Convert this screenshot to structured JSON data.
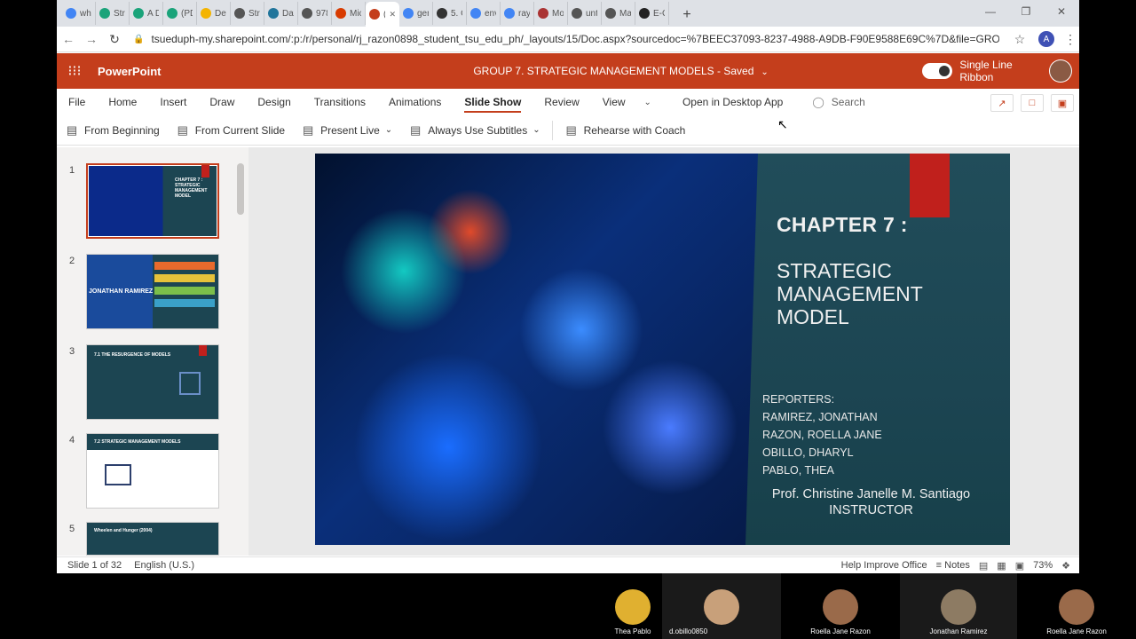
{
  "browser": {
    "tabs": [
      {
        "title": "wh",
        "icon": "google-icon",
        "color": "#4285f4"
      },
      {
        "title": "Stra",
        "icon": "r-icon",
        "color": "#1aa37a"
      },
      {
        "title": "A Di",
        "icon": "r-icon",
        "color": "#1aa37a"
      },
      {
        "title": "(PD",
        "icon": "r-icon",
        "color": "#1aa37a"
      },
      {
        "title": "Dev",
        "icon": "slides-icon",
        "color": "#f4b400"
      },
      {
        "title": "Stra",
        "icon": "bulb-icon",
        "color": "#555555"
      },
      {
        "title": "Dav",
        "icon": "wordpress-icon",
        "color": "#21759b"
      },
      {
        "title": "978",
        "icon": "globe-icon",
        "color": "#555555"
      },
      {
        "title": "Mic",
        "icon": "office-icon",
        "color": "#d83b01"
      },
      {
        "title": "(",
        "icon": "powerpoint-icon",
        "color": "#c43e1c",
        "active": true
      },
      {
        "title": "gen",
        "icon": "google-icon",
        "color": "#4285f4"
      },
      {
        "title": "5. G",
        "icon": "wix-icon",
        "color": "#333333"
      },
      {
        "title": "env",
        "icon": "google-icon",
        "color": "#4285f4"
      },
      {
        "title": "rayp",
        "icon": "google-icon",
        "color": "#4285f4"
      },
      {
        "title": "Mo",
        "icon": "doc-icon",
        "color": "#a33"
      },
      {
        "title": "unti",
        "icon": "globe-icon",
        "color": "#555555"
      },
      {
        "title": "Mar",
        "icon": "globe-icon",
        "color": "#555555"
      },
      {
        "title": "E-C",
        "icon": "amazon-icon",
        "color": "#222222"
      }
    ],
    "url": "tsueduph-my.sharepoint.com/:p:/r/personal/rj_razon0898_student_tsu_edu_ph/_layouts/15/Doc.aspx?sourcedoc=%7BEEC37093-8237-4988-A9DB-F90E9588E69C%7D&file=GRO...",
    "profile_initial": "A"
  },
  "office": {
    "app_name": "PowerPoint",
    "doc_title": "GROUP 7. STRATEGIC MANAGEMENT MODELS  -  Saved",
    "single_line_ribbon": "Single Line Ribbon"
  },
  "ribbon": {
    "tabs": [
      "File",
      "Home",
      "Insert",
      "Draw",
      "Design",
      "Transitions",
      "Animations",
      "Slide Show",
      "Review",
      "View"
    ],
    "active_tab": "Slide Show",
    "open_desktop": "Open in Desktop App",
    "search_placeholder": "Search"
  },
  "commands": {
    "from_beginning": "From Beginning",
    "from_current": "From Current Slide",
    "present_live": "Present Live",
    "subtitles": "Always Use Subtitles",
    "rehearse": "Rehearse with Coach"
  },
  "thumbnails": [
    {
      "num": "1",
      "title": "CHAPTER 7 : STRATEGIC MANAGEMENT MODEL",
      "selected": true
    },
    {
      "num": "2",
      "title": "JONATHAN RAMIREZ"
    },
    {
      "num": "3",
      "title": "7.1 THE RESURGENCE OF MODELS"
    },
    {
      "num": "4",
      "title": "7.2 STRATEGIC MANAGEMENT MODELS"
    },
    {
      "num": "5",
      "title": "Wheelen and Hunger (2004)"
    }
  ],
  "slide": {
    "chapter": "CHAPTER 7 :",
    "title": "STRATEGIC MANAGEMENT MODEL",
    "reporters_label": "REPORTERS:",
    "reporters": [
      "RAMIREZ, JONATHAN",
      "RAZON, ROELLA JANE",
      "OBILLO, DHARYL",
      "PABLO, THEA"
    ],
    "professor": "Prof. Christine Janelle M. Santiago",
    "professor_role": "INSTRUCTOR"
  },
  "status": {
    "slide_count": "Slide 1 of 32",
    "language": "English (U.S.)",
    "help": "Help Improve Office",
    "notes": "Notes",
    "zoom": "73%"
  },
  "participants": [
    {
      "name": "Thea Pablo",
      "color": "#e0b030"
    },
    {
      "name": "d.obillo0850",
      "color": "#c8a07a"
    },
    {
      "name": "Roella Jane Razon",
      "color": "#9a6a4a"
    },
    {
      "name": "Jonathan Ramirez",
      "color": "#8d7b63"
    },
    {
      "name": "Roella Jane Razon",
      "color": "#9a6a4a"
    }
  ],
  "colors": {
    "brand": "#c43e1c",
    "slide_panel": "#1c4552",
    "accent_red": "#c0201c"
  }
}
